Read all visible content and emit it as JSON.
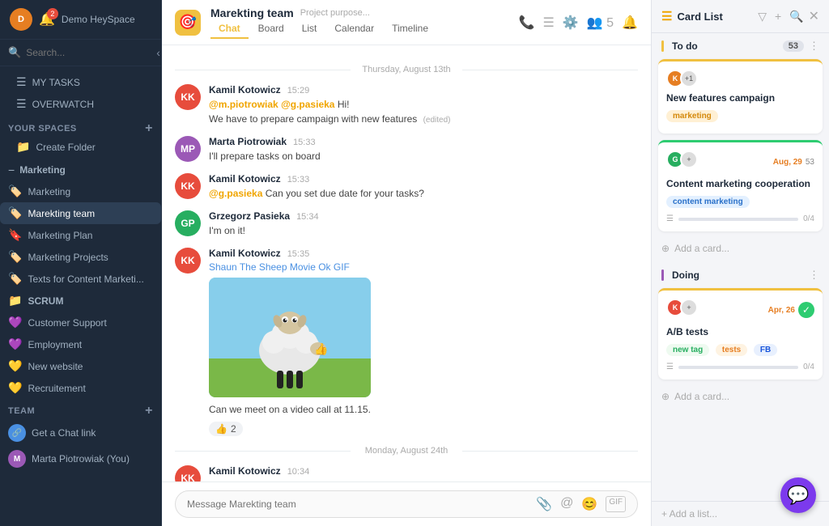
{
  "sidebar": {
    "user_avatar_initials": "D",
    "notification_count": "2",
    "demo_label": "Demo HeySpace",
    "search_placeholder": "Search...",
    "my_tasks_label": "MY TASKS",
    "overwatch_label": "OVERWATCH",
    "your_spaces_label": "YOUR SPACES",
    "create_folder_label": "Create Folder",
    "groups": [
      {
        "name": "Marketing",
        "icon": "📁",
        "items": [
          {
            "label": "Marketing",
            "icon": "🏷️",
            "active": false
          },
          {
            "label": "Marekting team",
            "icon": "🏷️",
            "active": true
          },
          {
            "label": "Marketing Plan",
            "icon": "🔖",
            "active": false
          },
          {
            "label": "Marketing Projects",
            "icon": "🏷️",
            "active": false
          },
          {
            "label": "Texts for Content Marketi...",
            "icon": "🏷️",
            "active": false
          }
        ]
      },
      {
        "name": "SCRUM",
        "icon": "📁",
        "items": []
      }
    ],
    "standalone_items": [
      {
        "label": "Customer Support",
        "icon": "💜"
      },
      {
        "label": "Employment",
        "icon": "💜"
      },
      {
        "label": "New website",
        "icon": "💛"
      },
      {
        "label": "Recruitement",
        "icon": "💛"
      }
    ],
    "team_label": "TEAM",
    "team_items": [
      {
        "label": "Get a Chat link",
        "avatar": "🔗"
      },
      {
        "label": "Marta Piotrowiak (You)",
        "avatar": "M"
      }
    ]
  },
  "chat": {
    "header": {
      "logo_emoji": "🎯",
      "title": "Marekting team",
      "subtitle": "Project purpose...",
      "tabs": [
        "Chat",
        "Board",
        "List",
        "Calendar",
        "Timeline"
      ],
      "active_tab": "Chat"
    },
    "date1": "Thursday, August 13th",
    "messages": [
      {
        "id": 1,
        "avatar_color": "#e74c3c",
        "avatar_initials": "KK",
        "name": "Kamil Kotowicz",
        "time": "15:29",
        "text": "@m.piotrowiak @g.pasieka Hi!",
        "mentions": [
          "@m.piotrowiak",
          "@g.pasieka"
        ],
        "edited": false,
        "extra": "We have to prepare campaign with new features",
        "has_edited": true
      },
      {
        "id": 2,
        "avatar_color": "#9b59b6",
        "avatar_initials": "MP",
        "name": "Marta Piotrowiak",
        "time": "15:33",
        "text": "I'll prepare tasks on board"
      },
      {
        "id": 3,
        "avatar_color": "#e74c3c",
        "avatar_initials": "KK",
        "name": "Kamil Kotowicz",
        "time": "15:33",
        "text": "@g.pasieka Can you set due date for your tasks?",
        "mentions": [
          "@g.pasieka"
        ]
      },
      {
        "id": 4,
        "avatar_color": "#27ae60",
        "avatar_initials": "GP",
        "name": "Grzegorz Pasieka",
        "time": "15:34",
        "text": "I'm on it!"
      },
      {
        "id": 5,
        "avatar_color": "#e74c3c",
        "avatar_initials": "KK",
        "name": "Kamil Kotowicz",
        "time": "15:35",
        "link_text": "Shaun The Sheep Movie Ok GIF",
        "has_gif": true,
        "reaction": "👍",
        "reaction_count": "2",
        "text": "Can we meet on a video call at 11.15."
      }
    ],
    "date2": "Monday, August 24th",
    "last_message": {
      "avatar_color": "#e74c3c",
      "avatar_initials": "KK",
      "name": "Kamil Kotowicz",
      "time": "10:34"
    },
    "input_placeholder": "Message Marekting team"
  },
  "card_panel": {
    "title": "Card List",
    "title_icon": "☰",
    "columns": [
      {
        "name": "To do",
        "count": "53",
        "cards": [
          {
            "title": "New features campaign",
            "tag": "marketing",
            "tag_type": "marketing",
            "avatar_color": "#e67e22",
            "avatar_initials": "K",
            "extra_count": "+1",
            "highlight": "yellow"
          },
          {
            "title": "Content marketing cooperation",
            "tag": "content marketing",
            "tag_type": "content",
            "avatar_color": "#27ae60",
            "avatar_initials": "G",
            "extra_count": "+",
            "date": "Aug, 29",
            "date_style": "orange",
            "subtask_count": "53",
            "progress": 0,
            "progress_text": "0/4",
            "highlight": "green"
          }
        ]
      },
      {
        "name": "Doing",
        "cards": [
          {
            "title": "A/B tests",
            "tags": [
              "new tag",
              "tests",
              "FB"
            ],
            "avatar_color": "#e74c3c",
            "avatar_initials": "K",
            "date": "Apr, 26",
            "date_style": "orange",
            "completed": true,
            "progress": 0,
            "progress_text": "0/4",
            "highlight": "yellow"
          }
        ]
      }
    ],
    "add_card_label": "Add a card...",
    "add_list_label": "+ Add a list..."
  }
}
